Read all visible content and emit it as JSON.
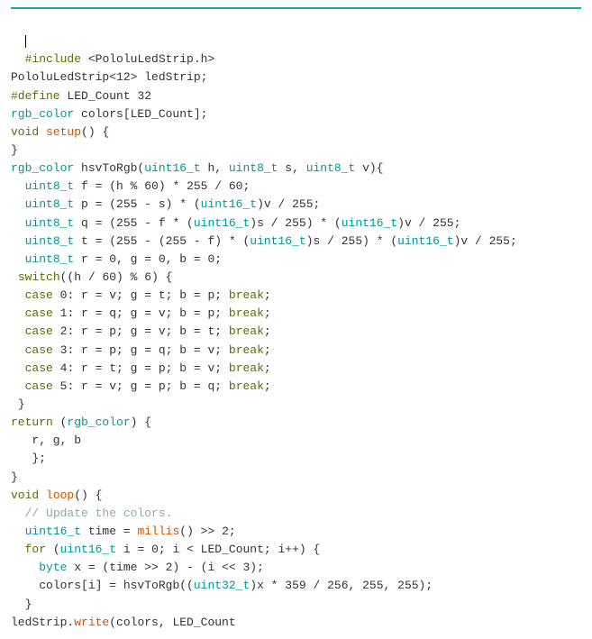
{
  "code": {
    "lines": [
      {
        "indent": "  ",
        "tokens": [
          {
            "cls": "k-pre",
            "t": "#include "
          },
          {
            "cls": "k-op",
            "t": "<"
          },
          {
            "cls": "k-id",
            "t": "PololuLedStrip"
          },
          {
            "cls": "k-op",
            "t": "."
          },
          {
            "cls": "k-id",
            "t": "h"
          },
          {
            "cls": "k-op",
            "t": ">"
          }
        ]
      },
      {
        "indent": "",
        "tokens": [
          {
            "cls": "k-id",
            "t": "PololuLedStrip"
          },
          {
            "cls": "k-op",
            "t": "<"
          },
          {
            "cls": "k-num",
            "t": "12"
          },
          {
            "cls": "k-op",
            "t": "> ledStrip;"
          }
        ]
      },
      {
        "indent": "",
        "tokens": [
          {
            "cls": "k-pre",
            "t": "#define"
          },
          {
            "cls": "k-id",
            "t": " LED_Count "
          },
          {
            "cls": "k-num",
            "t": "32"
          }
        ]
      },
      {
        "indent": "",
        "tokens": [
          {
            "cls": "k-type",
            "t": "rgb_color"
          },
          {
            "cls": "k-id",
            "t": " colors[LED_Count];"
          }
        ]
      },
      {
        "indent": "",
        "tokens": [
          {
            "cls": "",
            "t": ""
          }
        ]
      },
      {
        "indent": "",
        "tokens": [
          {
            "cls": "k-kw",
            "t": "void"
          },
          {
            "cls": "k-id",
            "t": " "
          },
          {
            "cls": "k-fn",
            "t": "setup"
          },
          {
            "cls": "k-id",
            "t": "() {"
          }
        ]
      },
      {
        "indent": "",
        "tokens": [
          {
            "cls": "k-id",
            "t": "}"
          }
        ]
      },
      {
        "indent": "",
        "tokens": [
          {
            "cls": "",
            "t": ""
          }
        ]
      },
      {
        "indent": "",
        "tokens": [
          {
            "cls": "k-type",
            "t": "rgb_color"
          },
          {
            "cls": "k-id",
            "t": " hsvToRgb("
          },
          {
            "cls": "k-type",
            "t": "uint16_t"
          },
          {
            "cls": "k-id",
            "t": " h, "
          },
          {
            "cls": "k-type",
            "t": "uint8_t"
          },
          {
            "cls": "k-id",
            "t": " s, "
          },
          {
            "cls": "k-type",
            "t": "uint8_t"
          },
          {
            "cls": "k-id",
            "t": " v){"
          }
        ]
      },
      {
        "indent": "  ",
        "tokens": [
          {
            "cls": "k-type",
            "t": "uint8_t"
          },
          {
            "cls": "k-id",
            "t": " f = (h % "
          },
          {
            "cls": "k-num",
            "t": "60"
          },
          {
            "cls": "k-id",
            "t": ") * "
          },
          {
            "cls": "k-num",
            "t": "255"
          },
          {
            "cls": "k-id",
            "t": " / "
          },
          {
            "cls": "k-num",
            "t": "60"
          },
          {
            "cls": "k-id",
            "t": ";"
          }
        ]
      },
      {
        "indent": "  ",
        "tokens": [
          {
            "cls": "k-type",
            "t": "uint8_t"
          },
          {
            "cls": "k-id",
            "t": " p = ("
          },
          {
            "cls": "k-num",
            "t": "255"
          },
          {
            "cls": "k-id",
            "t": " - s) * ("
          },
          {
            "cls": "k-type",
            "t": "uint16_t"
          },
          {
            "cls": "k-id",
            "t": ")v / "
          },
          {
            "cls": "k-num",
            "t": "255"
          },
          {
            "cls": "k-id",
            "t": ";"
          }
        ]
      },
      {
        "indent": "  ",
        "tokens": [
          {
            "cls": "k-type",
            "t": "uint8_t"
          },
          {
            "cls": "k-id",
            "t": " q = ("
          },
          {
            "cls": "k-num",
            "t": "255"
          },
          {
            "cls": "k-id",
            "t": " - f * ("
          },
          {
            "cls": "k-type",
            "t": "uint16_t"
          },
          {
            "cls": "k-id",
            "t": ")s / "
          },
          {
            "cls": "k-num",
            "t": "255"
          },
          {
            "cls": "k-id",
            "t": ") * ("
          },
          {
            "cls": "k-type",
            "t": "uint16_t"
          },
          {
            "cls": "k-id",
            "t": ")v / "
          },
          {
            "cls": "k-num",
            "t": "255"
          },
          {
            "cls": "k-id",
            "t": ";"
          }
        ]
      },
      {
        "indent": "  ",
        "tokens": [
          {
            "cls": "k-type",
            "t": "uint8_t"
          },
          {
            "cls": "k-id",
            "t": " t = ("
          },
          {
            "cls": "k-num",
            "t": "255"
          },
          {
            "cls": "k-id",
            "t": " - ("
          },
          {
            "cls": "k-num",
            "t": "255"
          },
          {
            "cls": "k-id",
            "t": " - f) * ("
          },
          {
            "cls": "k-type",
            "t": "uint16_t"
          },
          {
            "cls": "k-id",
            "t": ")s / "
          },
          {
            "cls": "k-num",
            "t": "255"
          },
          {
            "cls": "k-id",
            "t": ") * ("
          },
          {
            "cls": "k-type",
            "t": "uint16_t"
          },
          {
            "cls": "k-id",
            "t": ")v / "
          },
          {
            "cls": "k-num",
            "t": "255"
          },
          {
            "cls": "k-id",
            "t": ";"
          }
        ]
      },
      {
        "indent": "  ",
        "tokens": [
          {
            "cls": "k-type",
            "t": "uint8_t"
          },
          {
            "cls": "k-id",
            "t": " r = "
          },
          {
            "cls": "k-num",
            "t": "0"
          },
          {
            "cls": "k-id",
            "t": ", g = "
          },
          {
            "cls": "k-num",
            "t": "0"
          },
          {
            "cls": "k-id",
            "t": ", b = "
          },
          {
            "cls": "k-num",
            "t": "0"
          },
          {
            "cls": "k-id",
            "t": ";"
          }
        ]
      },
      {
        "indent": " ",
        "tokens": [
          {
            "cls": "k-kw",
            "t": "switch"
          },
          {
            "cls": "k-id",
            "t": "((h / "
          },
          {
            "cls": "k-num",
            "t": "60"
          },
          {
            "cls": "k-id",
            "t": ") % "
          },
          {
            "cls": "k-num",
            "t": "6"
          },
          {
            "cls": "k-id",
            "t": ") {"
          }
        ]
      },
      {
        "indent": "  ",
        "tokens": [
          {
            "cls": "k-kw",
            "t": "case"
          },
          {
            "cls": "k-id",
            "t": " "
          },
          {
            "cls": "k-num",
            "t": "0"
          },
          {
            "cls": "k-id",
            "t": ": r = v; g = t; b = p; "
          },
          {
            "cls": "k-kw",
            "t": "break"
          },
          {
            "cls": "k-id",
            "t": ";"
          }
        ]
      },
      {
        "indent": "  ",
        "tokens": [
          {
            "cls": "k-kw",
            "t": "case"
          },
          {
            "cls": "k-id",
            "t": " "
          },
          {
            "cls": "k-num",
            "t": "1"
          },
          {
            "cls": "k-id",
            "t": ": r = q; g = v; b = p; "
          },
          {
            "cls": "k-kw",
            "t": "break"
          },
          {
            "cls": "k-id",
            "t": ";"
          }
        ]
      },
      {
        "indent": "  ",
        "tokens": [
          {
            "cls": "k-kw",
            "t": "case"
          },
          {
            "cls": "k-id",
            "t": " "
          },
          {
            "cls": "k-num",
            "t": "2"
          },
          {
            "cls": "k-id",
            "t": ": r = p; g = v; b = t; "
          },
          {
            "cls": "k-kw",
            "t": "break"
          },
          {
            "cls": "k-id",
            "t": ";"
          }
        ]
      },
      {
        "indent": "  ",
        "tokens": [
          {
            "cls": "k-kw",
            "t": "case"
          },
          {
            "cls": "k-id",
            "t": " "
          },
          {
            "cls": "k-num",
            "t": "3"
          },
          {
            "cls": "k-id",
            "t": ": r = p; g = q; b = v; "
          },
          {
            "cls": "k-kw",
            "t": "break"
          },
          {
            "cls": "k-id",
            "t": ";"
          }
        ]
      },
      {
        "indent": "  ",
        "tokens": [
          {
            "cls": "k-kw",
            "t": "case"
          },
          {
            "cls": "k-id",
            "t": " "
          },
          {
            "cls": "k-num",
            "t": "4"
          },
          {
            "cls": "k-id",
            "t": ": r = t; g = p; b = v; "
          },
          {
            "cls": "k-kw",
            "t": "break"
          },
          {
            "cls": "k-id",
            "t": ";"
          }
        ]
      },
      {
        "indent": "  ",
        "tokens": [
          {
            "cls": "k-kw",
            "t": "case"
          },
          {
            "cls": "k-id",
            "t": " "
          },
          {
            "cls": "k-num",
            "t": "5"
          },
          {
            "cls": "k-id",
            "t": ": r = v; g = p; b = q; "
          },
          {
            "cls": "k-kw",
            "t": "break"
          },
          {
            "cls": "k-id",
            "t": ";"
          }
        ]
      },
      {
        "indent": " ",
        "tokens": [
          {
            "cls": "k-id",
            "t": "}"
          }
        ]
      },
      {
        "indent": "",
        "tokens": [
          {
            "cls": "k-kw",
            "t": "return"
          },
          {
            "cls": "k-id",
            "t": " ("
          },
          {
            "cls": "k-type",
            "t": "rgb_color"
          },
          {
            "cls": "k-id",
            "t": ") {"
          }
        ]
      },
      {
        "indent": "   ",
        "tokens": [
          {
            "cls": "k-id",
            "t": "r, g, b"
          }
        ]
      },
      {
        "indent": "   ",
        "tokens": [
          {
            "cls": "k-id",
            "t": "};"
          }
        ]
      },
      {
        "indent": "",
        "tokens": [
          {
            "cls": "k-id",
            "t": "}"
          }
        ]
      },
      {
        "indent": "",
        "tokens": [
          {
            "cls": "",
            "t": ""
          }
        ]
      },
      {
        "indent": "",
        "tokens": [
          {
            "cls": "k-kw",
            "t": "void"
          },
          {
            "cls": "k-id",
            "t": " "
          },
          {
            "cls": "k-fn",
            "t": "loop"
          },
          {
            "cls": "k-id",
            "t": "() {"
          }
        ]
      },
      {
        "indent": "  ",
        "tokens": [
          {
            "cls": "k-cmt",
            "t": "// Update the colors."
          }
        ]
      },
      {
        "indent": "  ",
        "tokens": [
          {
            "cls": "k-type",
            "t": "uint16_t"
          },
          {
            "cls": "k-id",
            "t": " time = "
          },
          {
            "cls": "k-fn",
            "t": "millis"
          },
          {
            "cls": "k-id",
            "t": "() >> "
          },
          {
            "cls": "k-num",
            "t": "2"
          },
          {
            "cls": "k-id",
            "t": ";"
          }
        ]
      },
      {
        "indent": "  ",
        "tokens": [
          {
            "cls": "k-kw",
            "t": "for"
          },
          {
            "cls": "k-id",
            "t": " ("
          },
          {
            "cls": "k-type",
            "t": "uint16_t"
          },
          {
            "cls": "k-id",
            "t": " i = "
          },
          {
            "cls": "k-num",
            "t": "0"
          },
          {
            "cls": "k-id",
            "t": "; i < LED_Count; i++) {"
          }
        ]
      },
      {
        "indent": "    ",
        "tokens": [
          {
            "cls": "k-type",
            "t": "byte"
          },
          {
            "cls": "k-id",
            "t": " x = (time >> "
          },
          {
            "cls": "k-num",
            "t": "2"
          },
          {
            "cls": "k-id",
            "t": ") - (i << "
          },
          {
            "cls": "k-num",
            "t": "3"
          },
          {
            "cls": "k-id",
            "t": ");"
          }
        ]
      },
      {
        "indent": "    ",
        "tokens": [
          {
            "cls": "k-id",
            "t": "colors[i] = hsvToRgb(("
          },
          {
            "cls": "k-type",
            "t": "uint32_t"
          },
          {
            "cls": "k-id",
            "t": ")x * "
          },
          {
            "cls": "k-num",
            "t": "359"
          },
          {
            "cls": "k-id",
            "t": " / "
          },
          {
            "cls": "k-num",
            "t": "256"
          },
          {
            "cls": "k-id",
            "t": ", "
          },
          {
            "cls": "k-num",
            "t": "255"
          },
          {
            "cls": "k-id",
            "t": ", "
          },
          {
            "cls": "k-num",
            "t": "255"
          },
          {
            "cls": "k-id",
            "t": ");"
          }
        ]
      },
      {
        "indent": "  ",
        "tokens": [
          {
            "cls": "k-id",
            "t": "}"
          }
        ]
      },
      {
        "indent": "",
        "tokens": [
          {
            "cls": "k-id",
            "t": "ledStrip."
          },
          {
            "cls": "k-fn",
            "t": "write"
          },
          {
            "cls": "k-id",
            "t": "(colors, LED_Count"
          }
        ]
      }
    ]
  }
}
